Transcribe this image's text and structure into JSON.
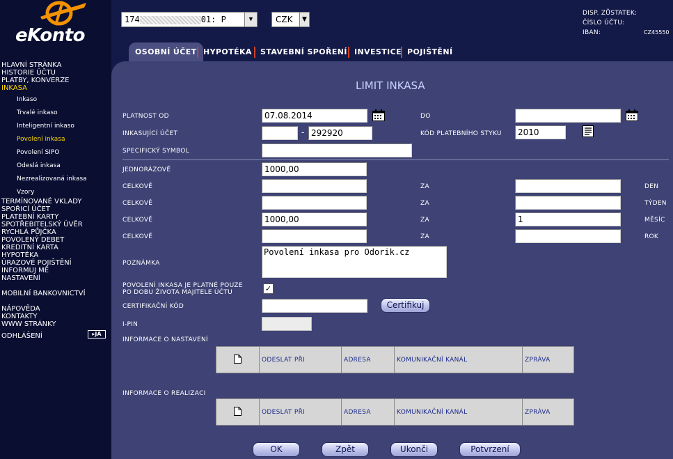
{
  "brand": {
    "name": "eKonto"
  },
  "sidebar": {
    "main_items": [
      {
        "label": "HLAVNÍ STRÁNKA"
      },
      {
        "label": "HISTORIE ÚČTU"
      },
      {
        "label": "PLATBY, KONVERZE"
      },
      {
        "label": "INKASA"
      }
    ],
    "sub_items": [
      {
        "label": "Inkaso"
      },
      {
        "label": "Trvalé inkaso"
      },
      {
        "label": "Inteligentní inkaso"
      },
      {
        "label": "Povolení inkasa"
      },
      {
        "label": "Povolení SIPO"
      },
      {
        "label": "Odeslá inkasa"
      },
      {
        "label": "Nezrealizovaná inkasa"
      },
      {
        "label": "Vzory"
      }
    ],
    "more_items": [
      {
        "label": "TERMÍNOVANÉ VKLADY"
      },
      {
        "label": "SPOŘICÍ ÚČET"
      },
      {
        "label": "PLATEBNÍ KARTY"
      },
      {
        "label": "SPOTŘEBITELSKÝ ÚVĚR"
      },
      {
        "label": "RYCHLÁ PŮJČKA"
      },
      {
        "label": "POVOLENÝ DEBET"
      },
      {
        "label": "KREDITNÍ KARTA"
      },
      {
        "label": "HYPOTÉKA"
      },
      {
        "label": "ÚRAZOVÉ POJIŠTĚNÍ"
      },
      {
        "label": "INFORMUJ MĚ"
      },
      {
        "label": "NASTAVENÍ"
      }
    ],
    "mobile": "MOBILNÍ BANKOVNICTVÍ",
    "help": "NÁPOVĚDA",
    "contacts": "KONTAKTY",
    "www": "WWW STRÁNKY",
    "logout": "ODHLÁŠENÍ",
    "lang": "JA"
  },
  "topbar": {
    "account_prefix": "174",
    "account_mid": "01: P",
    "currency": "CZK",
    "disp_label": "DISP. ZŮSTATEK:",
    "account_label": "ČÍSLO ÚČTU:",
    "iban_label": "IBAN:",
    "iban_value": "CZ45550"
  },
  "tabs": [
    {
      "label": "OSOBNÍ ÚČET"
    },
    {
      "label": "HYPOTÉKA"
    },
    {
      "label": "STAVEBNÍ SPOŘENÍ"
    },
    {
      "label": "INVESTICE"
    },
    {
      "label": "POJIŠTĚNÍ"
    }
  ],
  "page": {
    "title": "LIMIT INKASA"
  },
  "form": {
    "valid_from_label": "PLATNOST OD",
    "valid_from": "07.08.2014",
    "to_label": "DO",
    "to_value": "",
    "collector_account_label": "INKASUJÍCÍ ÚČET",
    "collector_prefix": "",
    "collector_dash": "-",
    "collector_number": "292920",
    "bank_code_label": "KÓD PLATEBNÍHO STYKU",
    "bank_code": "2010",
    "specific_symbol_label": "SPECIFICKÝ SYMBOL",
    "specific_symbol": "",
    "one_time_label": "JEDNORÁZOVĚ",
    "one_time_value": "1000,00",
    "total_label": "CELKOVĚ",
    "for_label": "ZA",
    "limits": [
      {
        "total": "",
        "count": "",
        "period": "DEN"
      },
      {
        "total": "",
        "count": "",
        "period": "TÝDEN"
      },
      {
        "total": "1000,00",
        "count": "1",
        "period": "MĚSÍC"
      },
      {
        "total": "",
        "count": "",
        "period": "ROK"
      }
    ],
    "note_label": "POZNÁMKA",
    "note": "Povolení inkasa pro Odorik.cz",
    "lifetime_label_1": "POVOLENÍ INKASA JE PLATNÉ POUZE",
    "lifetime_label_2": "PO DOBU ŽIVOTA MAJITELE ÚČTU",
    "lifetime_checked": "✓",
    "cert_code_label": "CERTIFIKAČNÍ KÓD",
    "cert_code": "",
    "certify_button": "Certifikuj",
    "ipin_label": "I-PIN",
    "ipin": ""
  },
  "settings_info": {
    "label": "INFORMACE O NASTAVENÍ",
    "columns": [
      "ODESLAT PŘI",
      "ADRESA",
      "KOMUNIKAČNÍ KANÁL",
      "ZPRÁVA"
    ]
  },
  "realization_info": {
    "label": "INFORMACE O REALIZACI",
    "columns": [
      "ODESLAT PŘI",
      "ADRESA",
      "KOMUNIKAČNÍ KANÁL",
      "ZPRÁVA"
    ]
  },
  "buttons": {
    "ok": "OK",
    "back": "Zpět",
    "finish": "Ukonči",
    "confirm": "Potvrzení"
  },
  "colors": {
    "sidebar_bg": "#0a0f32",
    "content_bg": "#3e4274",
    "accent": "#ffd800",
    "tab_separator": "#d04020"
  }
}
